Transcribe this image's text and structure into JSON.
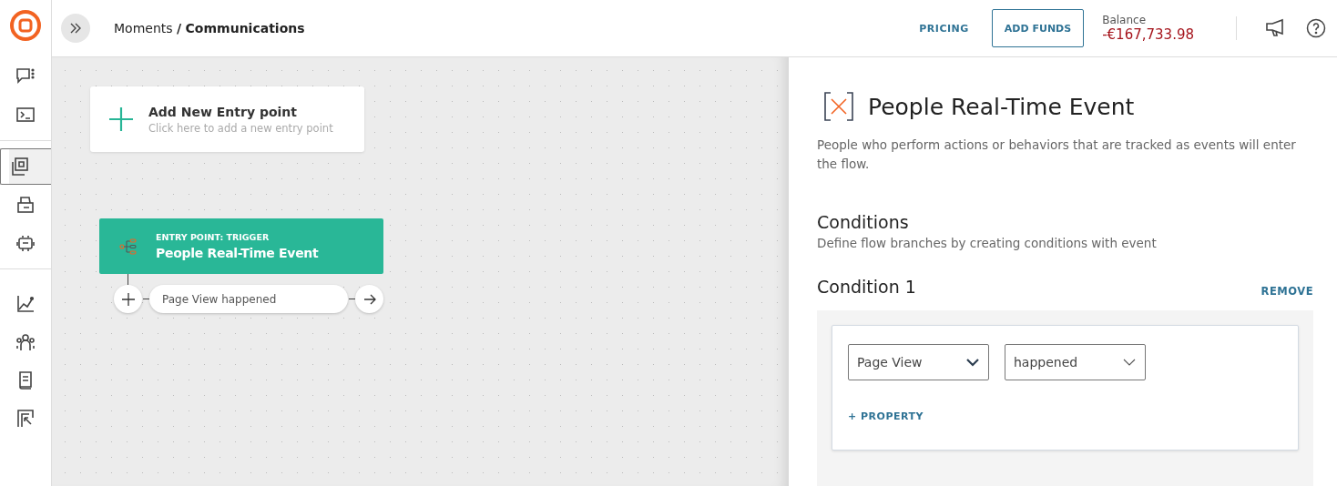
{
  "header": {
    "breadcrumb": {
      "parent": "Moments",
      "separator": "/",
      "current": "Communications"
    },
    "pricing": "PRICING",
    "add_funds": "ADD FUNDS",
    "balance_label": "Balance",
    "balance": "-€167,733.98"
  },
  "sidebar": {
    "groups": [
      {
        "items": [
          {
            "selected": false
          },
          {
            "selected": false
          }
        ]
      },
      {
        "items": [
          {
            "selected": true
          },
          {
            "selected": false
          },
          {
            "selected": false
          }
        ]
      },
      {
        "items": [
          {
            "selected": false
          },
          {
            "selected": false
          },
          {
            "selected": false
          },
          {
            "selected": false
          }
        ]
      }
    ]
  },
  "canvas": {
    "add_entry": {
      "title": "Add New Entry point",
      "subtitle": "Click here to add a new entry point"
    },
    "trigger": {
      "kicker": "ENTRY POINT: TRIGGER",
      "title": "People Real-Time Event"
    },
    "branch": {
      "label": "Page View happened"
    }
  },
  "panel": {
    "title": "People Real-Time Event",
    "description": "People who perform actions or behaviors that are tracked as events will enter the flow.",
    "conditions_heading": "Conditions",
    "conditions_hint": "Define flow branches by creating conditions with event",
    "conditions": [
      {
        "title": "Condition 1",
        "remove": "REMOVE",
        "event": "Page View",
        "operator": "happened",
        "add_property": "+ PROPERTY"
      }
    ]
  }
}
